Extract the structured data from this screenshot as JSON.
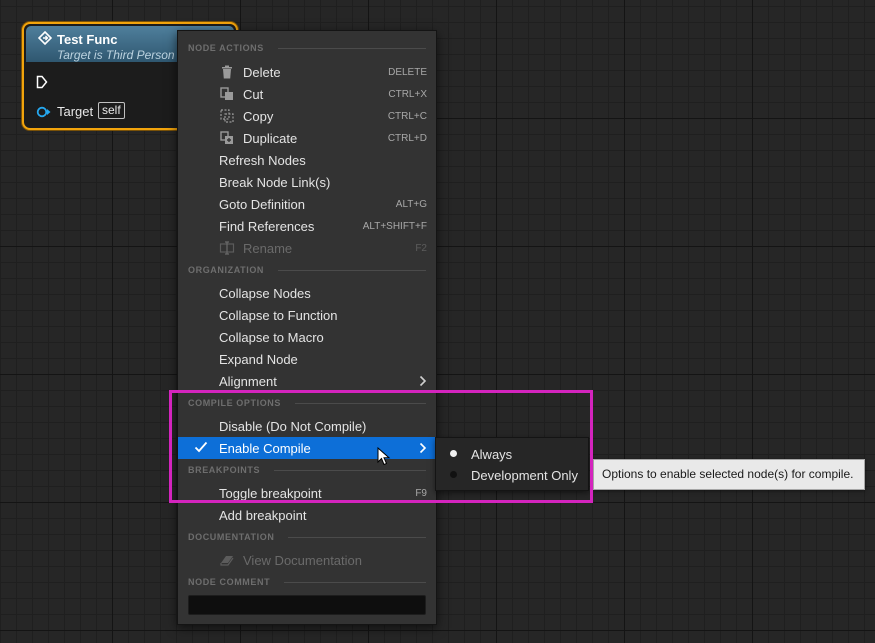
{
  "node": {
    "title": "Test Func",
    "subtitle": "Target is Third Person",
    "target_label": "Target",
    "self_label": "self",
    "header_color": "#3f6f8c",
    "border_color": "#f2a40c"
  },
  "menu": {
    "sections": {
      "node_actions": "NODE ACTIONS",
      "organization": "ORGANIZATION",
      "compile_options": "COMPILE OPTIONS",
      "breakpoints": "BREAKPOINTS",
      "documentation": "DOCUMENTATION",
      "node_comment": "NODE COMMENT"
    },
    "node_actions": [
      {
        "label": "Delete",
        "shortcut": "DELETE",
        "icon": "trash-icon"
      },
      {
        "label": "Cut",
        "shortcut": "CTRL+X",
        "icon": "cut-icon"
      },
      {
        "label": "Copy",
        "shortcut": "CTRL+C",
        "icon": "copy-icon"
      },
      {
        "label": "Duplicate",
        "shortcut": "CTRL+D",
        "icon": "duplicate-icon"
      },
      {
        "label": "Refresh Nodes",
        "shortcut": ""
      },
      {
        "label": "Break Node Link(s)",
        "shortcut": ""
      },
      {
        "label": "Goto Definition",
        "shortcut": "ALT+G"
      },
      {
        "label": "Find References",
        "shortcut": "ALT+SHIFT+F"
      },
      {
        "label": "Rename",
        "shortcut": "F2",
        "icon": "rename-icon",
        "disabled": true
      }
    ],
    "organization": [
      {
        "label": "Collapse Nodes"
      },
      {
        "label": "Collapse to Function"
      },
      {
        "label": "Collapse to Macro"
      },
      {
        "label": "Expand Node"
      },
      {
        "label": "Alignment",
        "submenu": true
      }
    ],
    "compile_options": [
      {
        "label": "Disable (Do Not Compile)"
      },
      {
        "label": "Enable Compile",
        "checked": true,
        "selected": true,
        "submenu": true
      }
    ],
    "breakpoints": [
      {
        "label": "Toggle breakpoint",
        "shortcut": "F9"
      },
      {
        "label": "Add breakpoint"
      }
    ],
    "documentation": [
      {
        "label": "View Documentation",
        "icon": "book-icon",
        "disabled": true
      }
    ],
    "selected_color": "#0d6fd8"
  },
  "submenu": {
    "items": [
      {
        "label": "Always",
        "selected": true
      },
      {
        "label": "Development Only",
        "selected": false
      }
    ]
  },
  "tooltip": {
    "text": "Options to enable selected node(s) for compile."
  },
  "highlight_color": "#d424be"
}
